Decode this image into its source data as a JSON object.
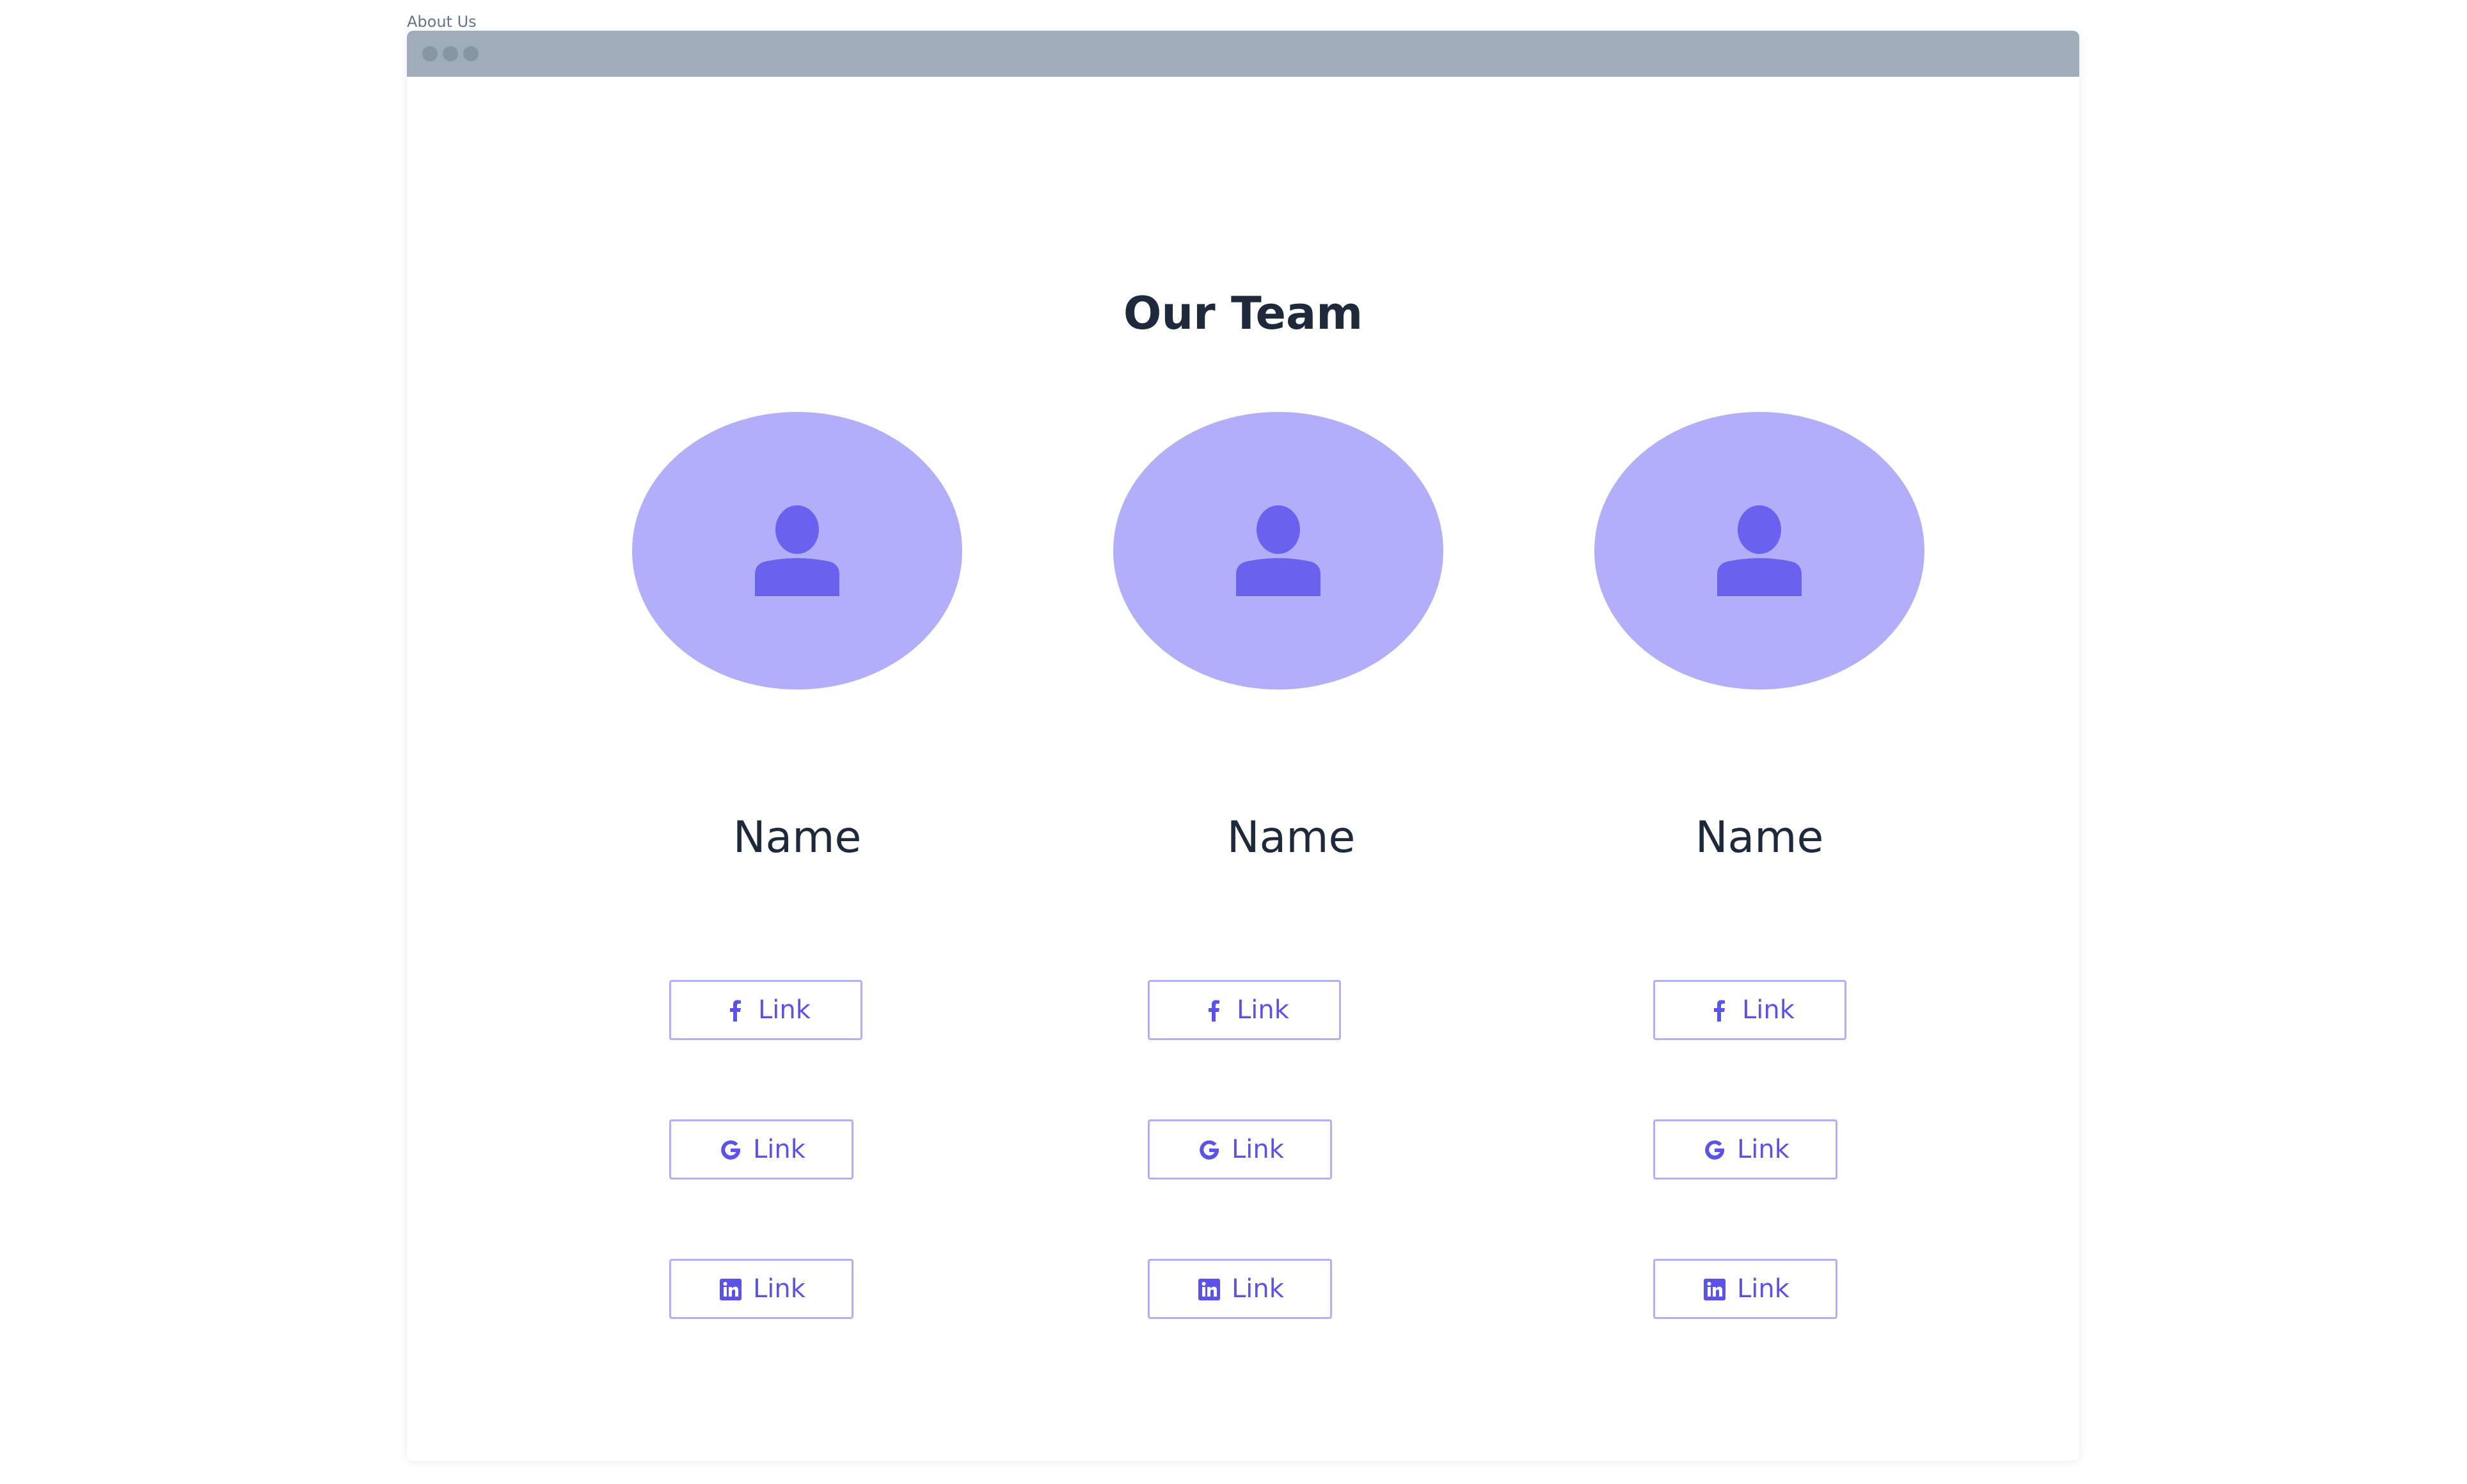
{
  "page": {
    "label": "About Us"
  },
  "main": {
    "title": "Our Team",
    "members": [
      {
        "name": "Name",
        "links": [
          {
            "icon": "facebook-icon",
            "label": "Link"
          },
          {
            "icon": "google-icon",
            "label": "Link"
          },
          {
            "icon": "linkedin-icon",
            "label": "Link"
          }
        ]
      },
      {
        "name": "Name",
        "links": [
          {
            "icon": "facebook-icon",
            "label": "Link"
          },
          {
            "icon": "google-icon",
            "label": "Link"
          },
          {
            "icon": "linkedin-icon",
            "label": "Link"
          }
        ]
      },
      {
        "name": "Name",
        "links": [
          {
            "icon": "facebook-icon",
            "label": "Link"
          },
          {
            "icon": "google-icon",
            "label": "Link"
          },
          {
            "icon": "linkedin-icon",
            "label": "Link"
          }
        ]
      }
    ]
  },
  "colors": {
    "accent": "#5b52ea",
    "avatar_bg": "#b3aef9",
    "title_bar": "#9eadb9",
    "text": "#1e293b"
  }
}
